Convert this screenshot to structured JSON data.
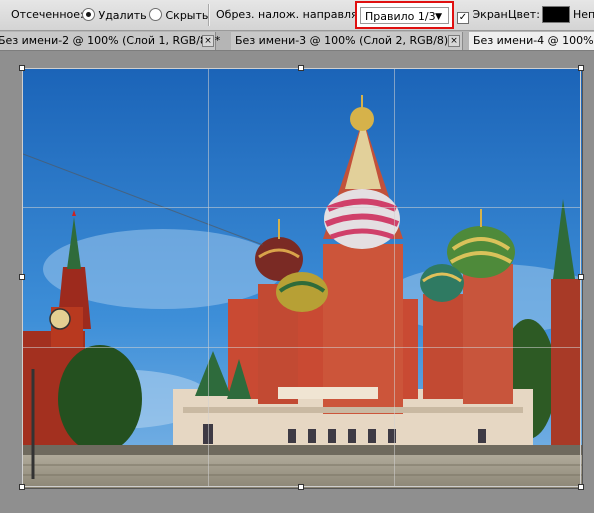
{
  "options_bar": {
    "cropped_label": "Отсеченное:",
    "delete_label": "Удалить",
    "hide_label": "Скрыть",
    "overlay_label": "Обрез. налож. направляющ",
    "overlay_value": "Правило 1/3",
    "screen_label": "Экран",
    "color_label": "Цвет:",
    "color_value": "#000000",
    "opacity_label": "Непр"
  },
  "tabs": [
    {
      "label": "Без имени-2 @ 100% (Слой 1, RGB/8) *",
      "active": false
    },
    {
      "label": "Без имени-3 @ 100% (Слой 2, RGB/8) *",
      "active": false
    },
    {
      "label": "Без имени-4 @ 100% (",
      "active": true
    }
  ]
}
